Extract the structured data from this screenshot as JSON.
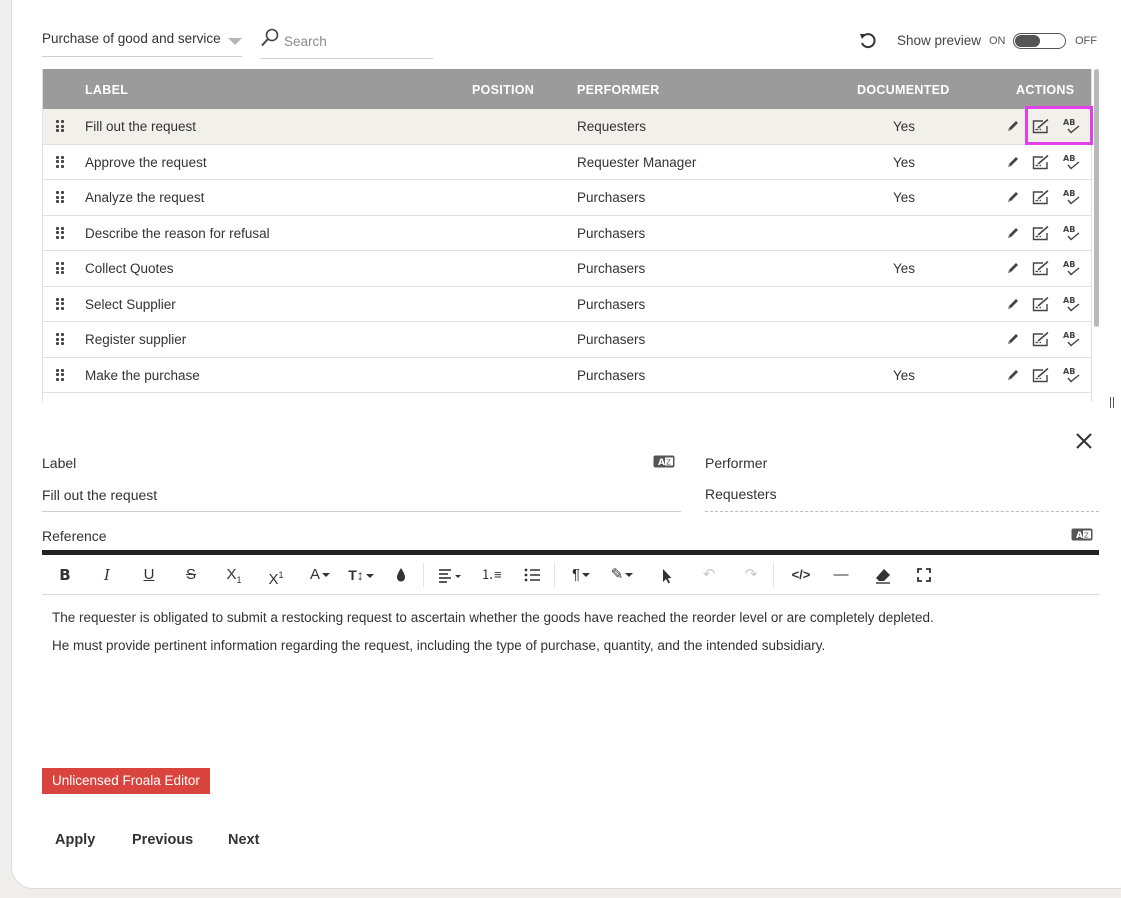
{
  "header": {
    "process_select": "Purchase of good and service",
    "search_placeholder": "Search",
    "show_preview_label": "Show preview",
    "toggle_on": "ON",
    "toggle_off": "OFF"
  },
  "table": {
    "columns": [
      "LABEL",
      "POSITION",
      "PERFORMER",
      "DOCUMENTED",
      "ACTIONS"
    ],
    "rows": [
      {
        "label": "Fill out the request",
        "position": "",
        "performer": "Requesters",
        "documented": "Yes"
      },
      {
        "label": "Approve the request",
        "position": "",
        "performer": "Requester Manager",
        "documented": "Yes"
      },
      {
        "label": "Analyze the request",
        "position": "",
        "performer": "Purchasers",
        "documented": "Yes"
      },
      {
        "label": "Describe the reason for refusal",
        "position": "",
        "performer": "Purchasers",
        "documented": ""
      },
      {
        "label": "Collect Quotes",
        "position": "",
        "performer": "Purchasers",
        "documented": "Yes"
      },
      {
        "label": "Select Supplier",
        "position": "",
        "performer": "Purchasers",
        "documented": ""
      },
      {
        "label": "Register supplier",
        "position": "",
        "performer": "Purchasers",
        "documented": ""
      },
      {
        "label": "Make the purchase",
        "position": "",
        "performer": "Purchasers",
        "documented": "Yes"
      }
    ],
    "action_icons": [
      "pencil-icon",
      "edit-document-icon",
      "spellcheck-icon"
    ]
  },
  "form": {
    "label_title": "Label",
    "label_value": "Fill out the request",
    "performer_title": "Performer",
    "performer_value": "Requesters",
    "reference_title": "Reference"
  },
  "editor": {
    "toolbar_icons": [
      "bold-icon",
      "italic-icon",
      "underline-icon",
      "strikethrough-icon",
      "subscript-icon",
      "superscript-icon",
      "font-family-icon",
      "font-size-icon",
      "text-color-icon",
      "align-icon",
      "ordered-list-icon",
      "unordered-list-icon",
      "paragraph-format-icon",
      "paragraph-style-icon",
      "select-all-icon",
      "undo-icon",
      "redo-icon",
      "code-view-icon",
      "horizontal-line-icon",
      "clear-formatting-icon",
      "fullscreen-icon"
    ],
    "paragraphs": [
      "The requester is obligated to submit a restocking request to ascertain whether the goods have reached the reorder level or are completely depleted.",
      "He must provide pertinent information regarding the request, including the type of purchase, quantity, and the intended subsidiary."
    ],
    "unlicensed_label": "Unlicensed Froala Editor"
  },
  "footer": {
    "apply": "Apply",
    "previous": "Previous",
    "next": "Next"
  },
  "colors": {
    "table_header": "#9b9b9b",
    "selected_row": "#f2f0ea",
    "highlight": "#e040e8",
    "unlicensed": "#d9443f"
  }
}
